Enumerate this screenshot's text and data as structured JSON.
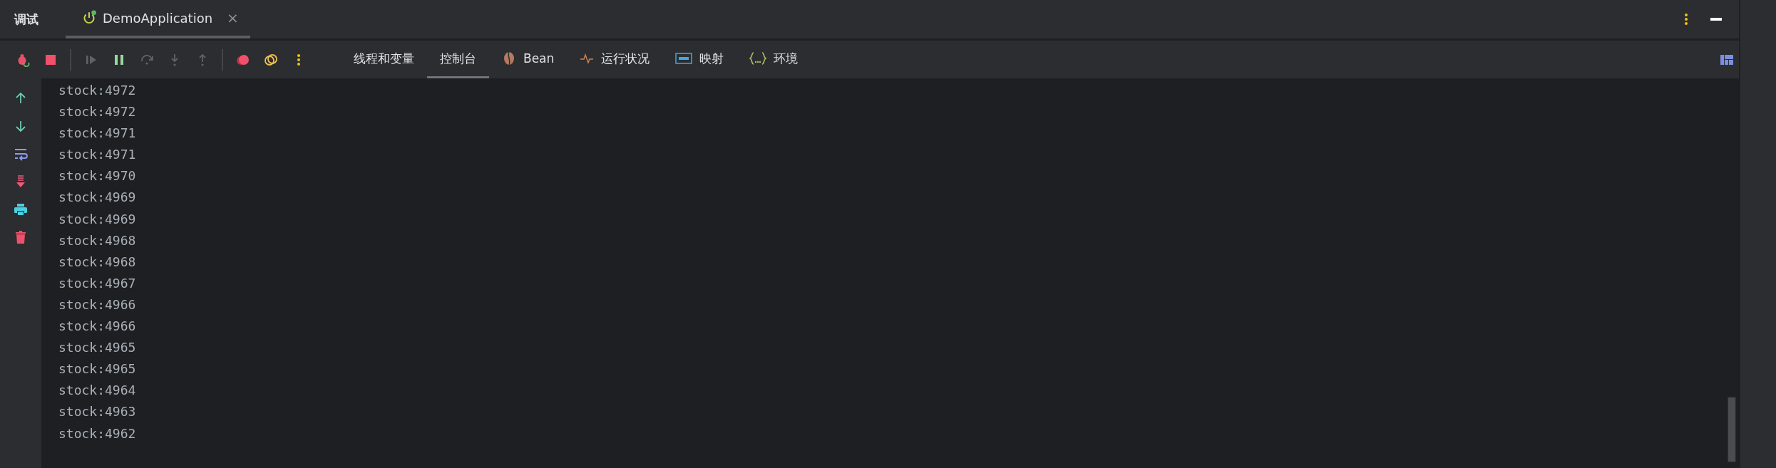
{
  "window": {
    "title": "调试"
  },
  "run_tab": {
    "label": "DemoApplication",
    "close": "×",
    "running": true,
    "selected": true
  },
  "toolbar": [
    {
      "kind": "debug",
      "disabled": false
    },
    {
      "kind": "stop",
      "disabled": false
    },
    {
      "kind": "sep"
    },
    {
      "kind": "resume",
      "disabled": true
    },
    {
      "kind": "pause",
      "disabled": false
    },
    {
      "kind": "over",
      "disabled": true
    },
    {
      "kind": "into",
      "disabled": true
    },
    {
      "kind": "out",
      "disabled": true
    },
    {
      "kind": "sep"
    },
    {
      "kind": "breakpoints",
      "disabled": false
    },
    {
      "kind": "mute",
      "disabled": false
    },
    {
      "kind": "more",
      "disabled": false
    }
  ],
  "tabs": [
    {
      "label": "线程和变量",
      "kind": "text",
      "selected": false
    },
    {
      "label": "控制台",
      "kind": "text",
      "selected": true
    },
    {
      "label": "Bean",
      "kind": "bean",
      "selected": false
    },
    {
      "label": "运行状况",
      "kind": "pulse",
      "selected": false
    },
    {
      "label": "映射",
      "kind": "api",
      "selected": false
    },
    {
      "label": "环境",
      "kind": "braces",
      "selected": false
    }
  ],
  "console": {
    "lines": [
      "stock:4972",
      "stock:4972",
      "stock:4971",
      "stock:4971",
      "stock:4970",
      "stock:4969",
      "stock:4969",
      "stock:4968",
      "stock:4968",
      "stock:4967",
      "stock:4966",
      "stock:4966",
      "stock:4965",
      "stock:4965",
      "stock:4964",
      "stock:4963",
      "stock:4962"
    ]
  }
}
